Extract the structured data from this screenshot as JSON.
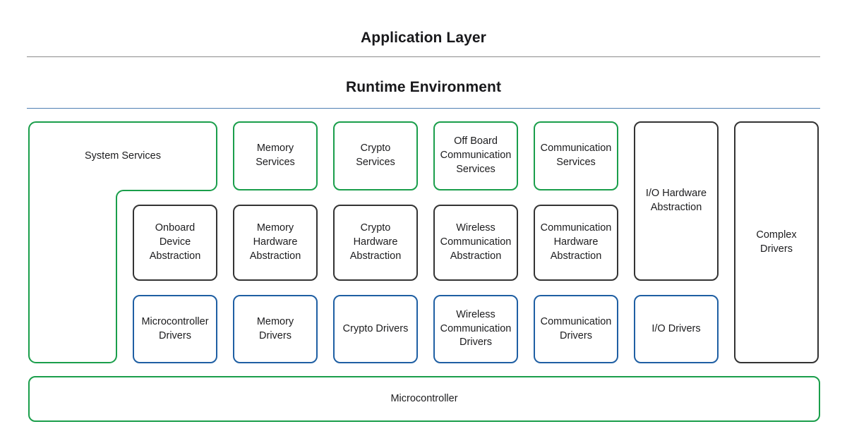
{
  "headings": {
    "application_layer": "Application Layer",
    "runtime_environment": "Runtime Environment"
  },
  "colors": {
    "service_green": "#1a9e4b",
    "driver_blue": "#1f5fa3",
    "abstraction_dark": "#333333",
    "divider_gray": "#8c8c8c",
    "divider_blue": "#4f7fb3",
    "text": "#1c1c1e",
    "background": "#ffffff"
  },
  "services_row": {
    "system_services": "System Services",
    "memory_services": "Memory Services",
    "crypto_services": "Crypto Services",
    "off_board_communication_services": "Off Board Communication Services",
    "communication_services": "Communication Services"
  },
  "abstraction_row": {
    "onboard_device_abstraction": "Onboard Device Abstraction",
    "memory_hardware_abstraction": "Memory Hardware Abstraction",
    "crypto_hardware_abstraction": "Crypto Hardware Abstraction",
    "wireless_communication_abstraction": "Wireless Communication Abstraction",
    "communication_hardware_abstraction": "Communication Hardware Abstraction",
    "io_hardware_abstraction": "I/O Hardware Abstraction"
  },
  "drivers_row": {
    "microcontroller_drivers": "Microcontroller Drivers",
    "memory_drivers": "Memory Drivers",
    "crypto_drivers": "Crypto Drivers",
    "wireless_communication_drivers": "Wireless Communication Drivers",
    "communication_drivers": "Communication Drivers",
    "io_drivers": "I/O Drivers"
  },
  "spanning": {
    "complex_drivers": "Complex Drivers"
  },
  "hardware": {
    "microcontroller": "Microcontroller"
  }
}
